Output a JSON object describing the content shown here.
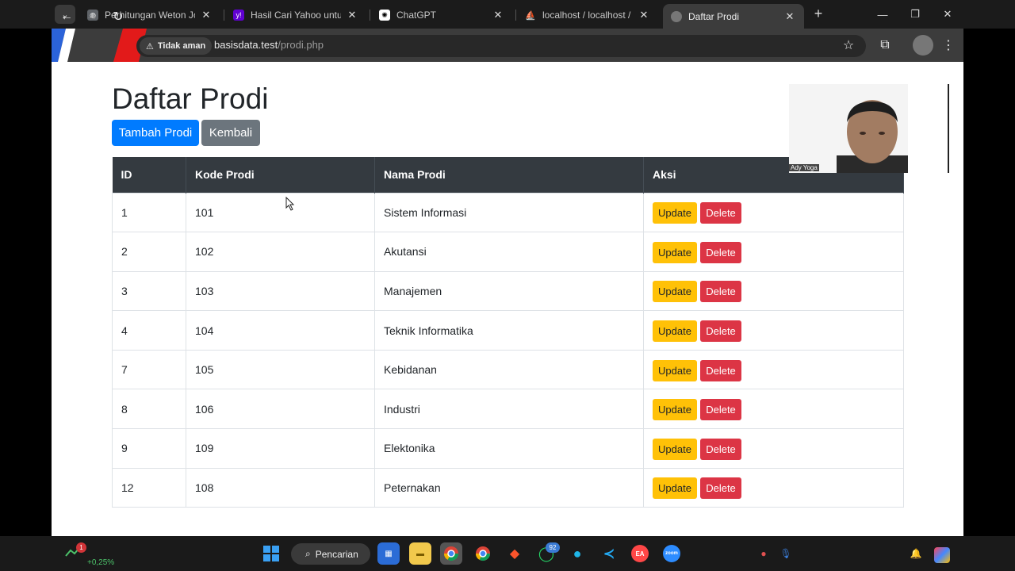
{
  "browser": {
    "tabs": [
      {
        "title": "Perhitungan Weton Jodo",
        "active": false
      },
      {
        "title": "Hasil Cari Yahoo untuk g",
        "active": false
      },
      {
        "title": "ChatGPT",
        "active": false
      },
      {
        "title": "localhost / localhost / ak",
        "active": false
      },
      {
        "title": "Daftar Prodi",
        "active": true
      }
    ],
    "security_label": "Tidak aman",
    "url_host": "basisdata.test",
    "url_path": "/prodi.php"
  },
  "page": {
    "title": "Daftar Prodi",
    "add_button": "Tambah Prodi",
    "back_button": "Kembali",
    "columns": [
      "ID",
      "Kode Prodi",
      "Nama Prodi",
      "Aksi"
    ],
    "rows": [
      {
        "id": "1",
        "kode": "101",
        "nama": "Sistem Informasi"
      },
      {
        "id": "2",
        "kode": "102",
        "nama": "Akutansi"
      },
      {
        "id": "3",
        "kode": "103",
        "nama": "Manajemen"
      },
      {
        "id": "4",
        "kode": "104",
        "nama": "Teknik Informatika"
      },
      {
        "id": "7",
        "kode": "105",
        "nama": "Kebidanan"
      },
      {
        "id": "8",
        "kode": "106",
        "nama": "Industri"
      },
      {
        "id": "9",
        "kode": "109",
        "nama": "Elektonika"
      },
      {
        "id": "12",
        "kode": "108",
        "nama": "Peternakan"
      }
    ],
    "update_label": "Update",
    "delete_label": "Delete",
    "webcam_caption": "Ady Yoga"
  },
  "taskbar": {
    "ticker_value": "+0,25%",
    "ticker_badge": "1",
    "search_label": "Pencarian",
    "whatsapp_badge": "92"
  },
  "colors": {
    "primary": "#007bff",
    "secondary": "#6c757d",
    "warning": "#ffc107",
    "danger": "#dc3545",
    "table_header": "#343a40"
  }
}
